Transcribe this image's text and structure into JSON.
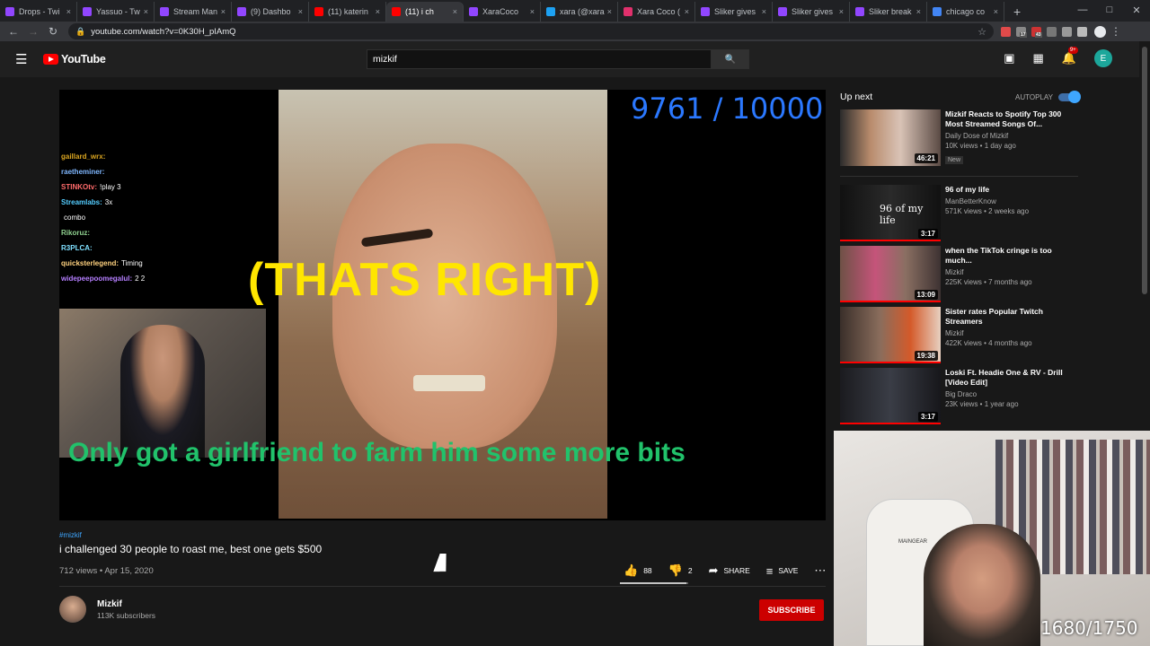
{
  "browser": {
    "tabs": [
      {
        "label": "Drops - Twi",
        "color": "#9146ff"
      },
      {
        "label": "Yassuo - Tw",
        "color": "#9146ff"
      },
      {
        "label": "Stream Man",
        "color": "#9146ff"
      },
      {
        "label": "(9) Dashbo",
        "color": "#9146ff"
      },
      {
        "label": "(11) katerin",
        "color": "#ff0000"
      },
      {
        "label": "(11) i ch",
        "color": "#ff0000",
        "active": true
      },
      {
        "label": "XaraCoco",
        "color": "#9146ff"
      },
      {
        "label": "xara (@xara",
        "color": "#1da1f2"
      },
      {
        "label": "Xara Coco (",
        "color": "#e1306c"
      },
      {
        "label": "Sliker gives",
        "color": "#9146ff"
      },
      {
        "label": "Sliker gives",
        "color": "#9146ff"
      },
      {
        "label": "Sliker break",
        "color": "#9146ff"
      },
      {
        "label": "chicago co",
        "color": "#4285f4"
      }
    ],
    "tab_close": "×",
    "new_tab": "+",
    "url": "youtube.com/watch?v=0K30H_pIAmQ",
    "extension_badges": [
      "17",
      "43"
    ]
  },
  "youtube": {
    "logo_text": "YouTube",
    "search_value": "mizkif",
    "notification_count": "9+",
    "avatar_letter": "E"
  },
  "player": {
    "sub_counter": "9761 / 10000",
    "caption_top": "(THATS RIGHT)",
    "caption_bottom": "Only got a girlfriend to farm him some more bits",
    "chat": [
      {
        "user": "gaillard_wrx:",
        "msg": "",
        "color": "#daa520"
      },
      {
        "user": "raetheminer:",
        "msg": "",
        "color": "#7fb7ff"
      },
      {
        "user": "STINKOtv:",
        "msg": "!play 3",
        "color": "#ff6b6b"
      },
      {
        "user": "Streamlabs:",
        "msg": "3x",
        "color": "#54cdff"
      },
      {
        "user": "",
        "msg": "combo",
        "color": "#fff"
      },
      {
        "user": "Rikoruz:",
        "msg": "",
        "color": "#8fd18f"
      },
      {
        "user": "R3PLCA:",
        "msg": "",
        "color": "#7fe0ff"
      },
      {
        "user": "quicksterlegend:",
        "msg": "Timing",
        "color": "#ffd27f"
      },
      {
        "user": "widepeepoomegalul:",
        "msg": "2  2",
        "color": "#b57fff"
      }
    ]
  },
  "video": {
    "hashtag": "#mizkif",
    "title": "i challenged 30 people to roast me, best one gets $500",
    "meta": "712 views • Apr 15, 2020",
    "likes": "88",
    "dislikes": "2",
    "like_ratio": 0.978,
    "share_label": "SHARE",
    "save_label": "SAVE",
    "channel_name": "Mizkif",
    "subscribers": "113K subscribers",
    "subscribe_label": "SUBSCRIBE"
  },
  "upnext": {
    "title": "Up next",
    "autoplay_label": "AUTOPLAY",
    "videos": [
      {
        "title": "Mizkif Reacts to Spotify Top 300 Most Streamed Songs Of...",
        "channel": "Daily Dose of Mizkif",
        "views": "10K views • 1 day ago",
        "duration": "46:21",
        "badge": "New",
        "thumb": "linear-gradient(90deg,#2b2b2b 0%,#b88b6c 30%,#d9c3b6 60%,#5a4a44 100%)"
      },
      {
        "title": "96 of my life",
        "channel": "ManBetterKnow",
        "views": "571K views • 2 weeks ago",
        "duration": "3:17",
        "thumb_text": "96 of my life",
        "thumb": "linear-gradient(90deg,#111 0%,#2a2a2a 50%,#111 100%)"
      },
      {
        "title": "when the TikTok cringe is too much...",
        "channel": "Mizkif",
        "views": "225K views • 7 months ago",
        "duration": "13:09",
        "thumb": "linear-gradient(90deg,#6e5146 0%,#c5547a 35%,#8a6f62 65%,#3d3232 100%)"
      },
      {
        "title": "Sister rates Popular Twitch Streamers",
        "channel": "Mizkif",
        "views": "422K views • 4 months ago",
        "duration": "19:38",
        "thumb": "linear-gradient(90deg,#3a2f2a 0%,#8a6d5c 40%,#d45a2a 70%,#e7d0c0 100%)"
      },
      {
        "title": "Loski Ft. Headie One & RV - Drill [Video Edit]",
        "channel": "Big Draco",
        "views": "23K views • 1 year ago",
        "duration": "3:17",
        "thumb": "linear-gradient(90deg,#1b1b1f 0%,#3a3d46 50%,#17171b 100%)"
      }
    ]
  },
  "overlay": {
    "cam_counter": "1680/1750",
    "chair_label": "MAINGEAR"
  },
  "colors": {
    "accent": "#3ea6ff",
    "subscribe": "#cc0000",
    "counter_blue": "#2b78ff",
    "caption_yellow": "#ffe600",
    "caption_green": "#21c26b"
  }
}
